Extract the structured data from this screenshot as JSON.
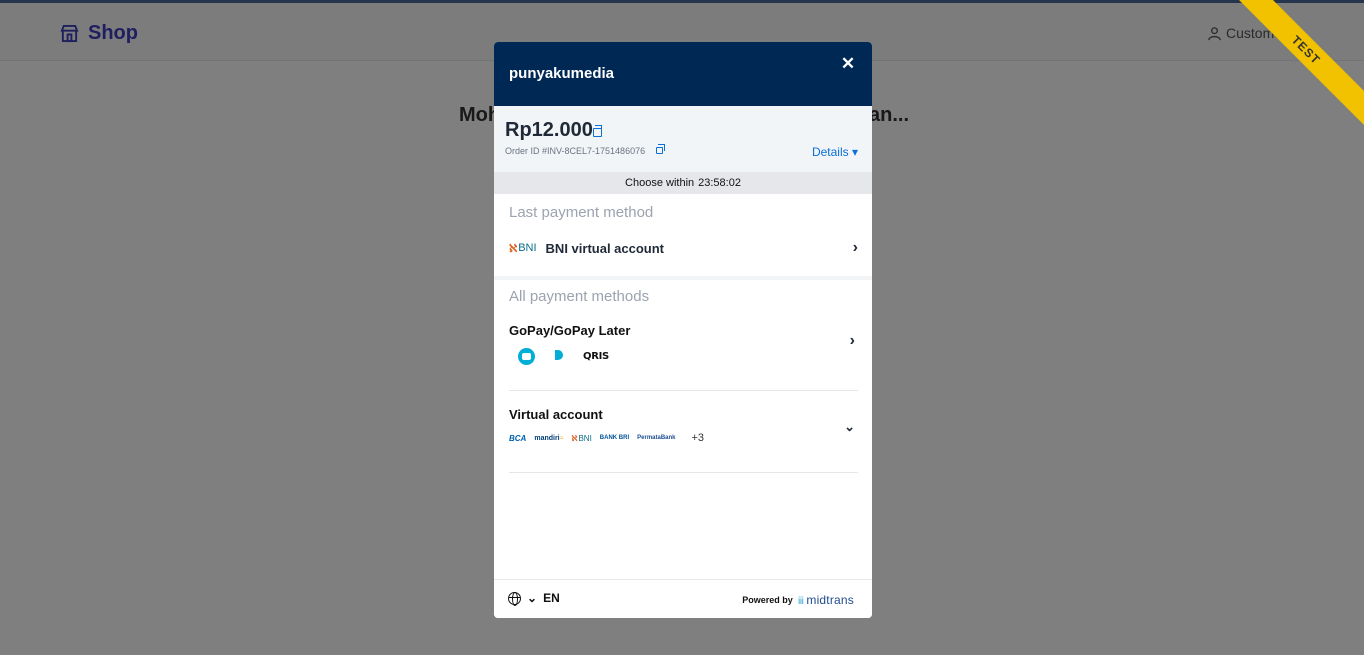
{
  "background": {
    "brand": "Shop",
    "user_label": "Customer",
    "message_left": "Moh",
    "message_right": "an...",
    "ribbon": "TEST"
  },
  "modal": {
    "merchant": "punyakumedia",
    "close_symbol": "✕",
    "amount": "Rp12.000",
    "order_id": "Order ID #INV-8CEL7-1751486076",
    "details_label": "Details ▾",
    "timer_label": "Choose within",
    "timer_value": "23:58:02",
    "last_section_label": "Last payment method",
    "last_method": {
      "bank_logo": "BNI",
      "name": "BNI virtual account"
    },
    "all_section_label": "All payment methods",
    "methods": [
      {
        "name": "GoPay/GoPay Later",
        "icons": [
          "gopay-icon",
          "gopay-later-icon",
          "qris-icon"
        ],
        "qris_label": "QRIS"
      },
      {
        "name": "Virtual account",
        "banks": [
          "BCA",
          "mandiri",
          "BNI",
          "BANK BRI",
          "PermataBank"
        ],
        "more": "+3"
      }
    ],
    "footer": {
      "language": "EN",
      "powered_by": "Powered by",
      "provider": "midtrans"
    }
  }
}
